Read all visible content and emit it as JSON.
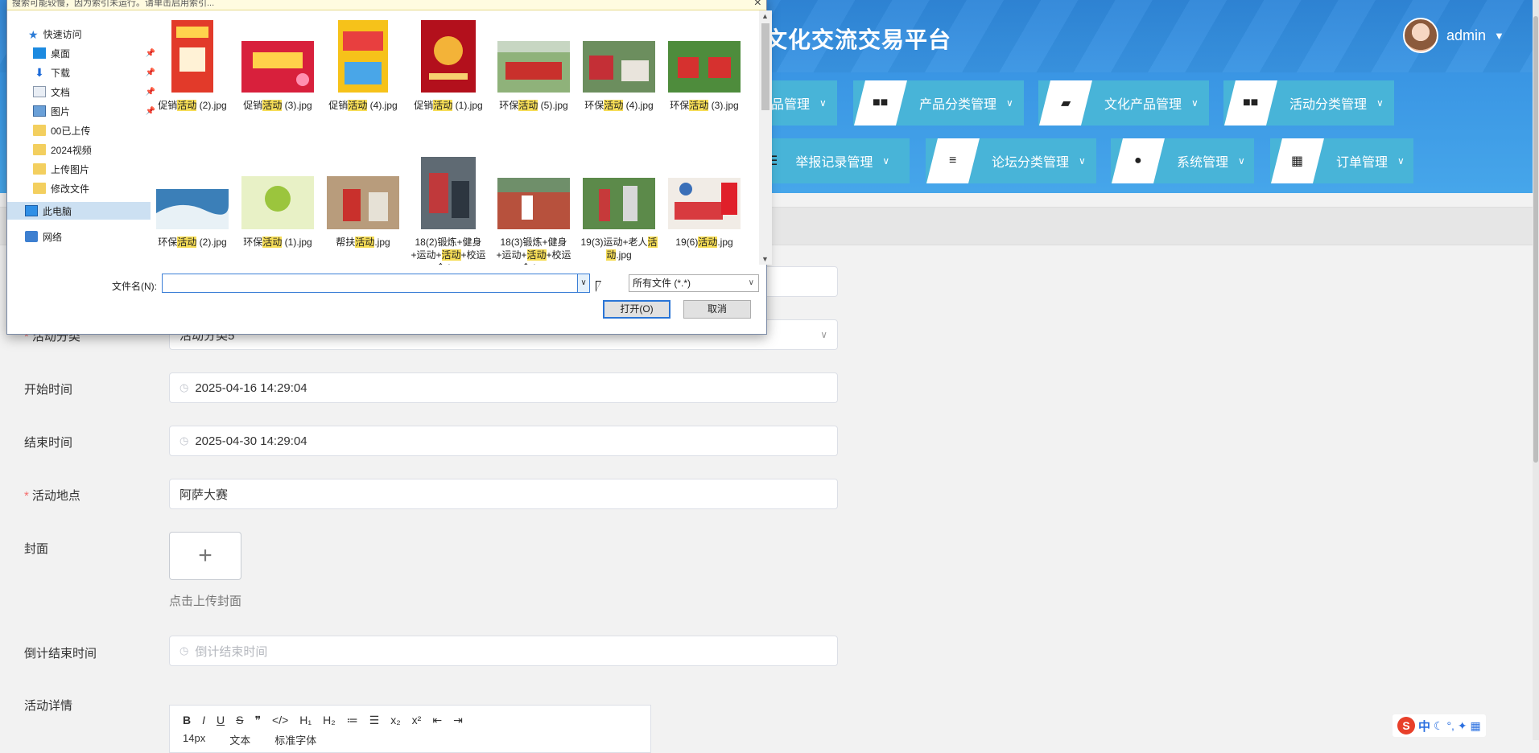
{
  "app": {
    "title": "文化交流交易平台",
    "user": "admin",
    "nav_row1": [
      {
        "label": "品管理",
        "icon": "grid-icon"
      },
      {
        "label": "产品分类管理",
        "icon": "grid-icon"
      },
      {
        "label": "文化产品管理",
        "icon": "wallet-icon"
      },
      {
        "label": "活动分类管理",
        "icon": "grid-icon"
      }
    ],
    "nav_row2": [
      {
        "label": "举报记录管理",
        "icon": "list-icon"
      },
      {
        "label": "论坛分类管理",
        "icon": "sliders-icon"
      },
      {
        "label": "系统管理",
        "icon": "bulb-icon"
      },
      {
        "label": "订单管理",
        "icon": "apps-icon"
      }
    ]
  },
  "form": {
    "category_label": "活动分类",
    "category_value": "活动分类5",
    "start_label": "开始时间",
    "start_value": "2025-04-16 14:29:04",
    "end_label": "结束时间",
    "end_value": "2025-04-30 14:29:04",
    "location_label": "活动地点",
    "location_value": "阿萨大赛",
    "cover_label": "封面",
    "cover_tip": "点击上传封面",
    "countdown_label": "倒计结束时间",
    "countdown_placeholder": "倒计结束时间",
    "detail_label": "活动详情",
    "editor_row2": [
      "14px",
      "文本",
      "标准字体"
    ]
  },
  "dialog": {
    "notice": "搜索可能较慢，因为索引未运行。请单击启用索引...",
    "nav": {
      "quick_access": "快速访问",
      "desktop": "桌面",
      "downloads": "下载",
      "documents": "文档",
      "pictures": "图片",
      "folder1": "00已上传",
      "folder2": "2024视频",
      "folder3": "上传图片",
      "folder4": "修改文件",
      "this_pc": "此电脑",
      "network": "网络"
    },
    "files": [
      {
        "pre": "促销",
        "hl": "活动",
        "post": " (2).jpg"
      },
      {
        "pre": "促销",
        "hl": "活动",
        "post": " (3).jpg"
      },
      {
        "pre": "促销",
        "hl": "活动",
        "post": " (4).jpg"
      },
      {
        "pre": "促销",
        "hl": "活动",
        "post": " (1).jpg"
      },
      {
        "pre": "环保",
        "hl": "活动",
        "post": " (5).jpg"
      },
      {
        "pre": "环保",
        "hl": "活动",
        "post": " (4).jpg"
      },
      {
        "pre": "环保",
        "hl": "活动",
        "post": " (3).jpg"
      },
      {
        "pre": "环保",
        "hl": "活动",
        "post": " (2).jpg"
      },
      {
        "pre": "环保",
        "hl": "活动",
        "post": " (1).jpg"
      },
      {
        "pre": "帮扶",
        "hl": "活动",
        "post": ".jpg"
      },
      {
        "pre": "18(2)锻炼+健身+运动+",
        "hl": "活动",
        "post": "+校运会.jpg"
      },
      {
        "pre": "18(3)锻炼+健身+运动+",
        "hl": "活动",
        "post": "+校运会.jpg"
      },
      {
        "pre": "19(3)运动+老人",
        "hl": "活动",
        "post": ".jpg"
      },
      {
        "pre": "19(6)",
        "hl": "活动",
        "post": ".jpg"
      }
    ],
    "filename_label": "文件名(N):",
    "filename_value": "",
    "filetype": "所有文件 (*.*)",
    "open_button": "打开(O)",
    "cancel_button": "取消"
  },
  "ime": {
    "s": "S",
    "lang": "中",
    "icons": "☾ °, ✦ ▦"
  }
}
